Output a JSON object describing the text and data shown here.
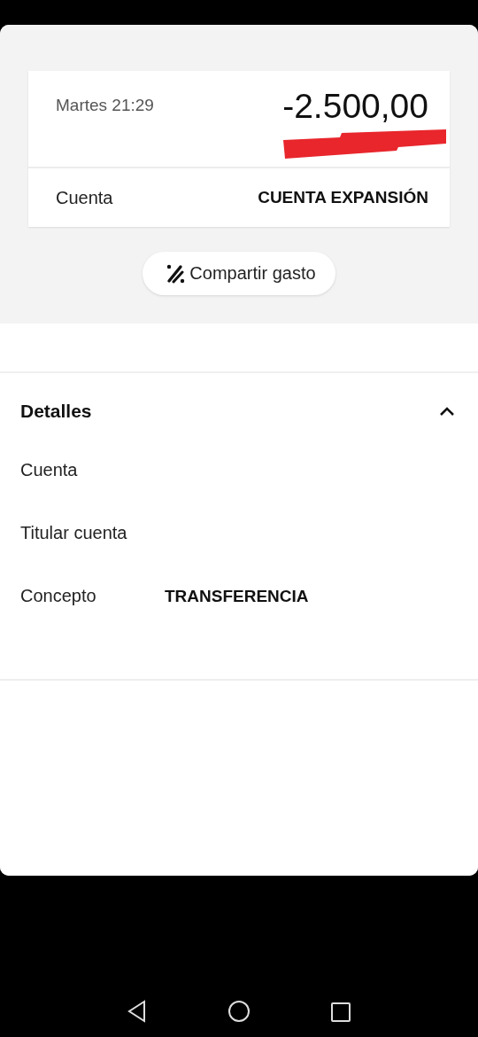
{
  "summary": {
    "datetime": "Martes 21:29",
    "amount": "-2.500,00",
    "account_label": "Cuenta",
    "account_value": "CUENTA EXPANSIÓN"
  },
  "share_button": {
    "label": "Compartir gasto"
  },
  "details": {
    "title": "Detalles",
    "expanded": true,
    "rows": [
      {
        "label": "Cuenta"
      },
      {
        "label": "Titular cuenta"
      },
      {
        "label": "Concepto",
        "value": "TRANSFERENCIA"
      }
    ]
  }
}
